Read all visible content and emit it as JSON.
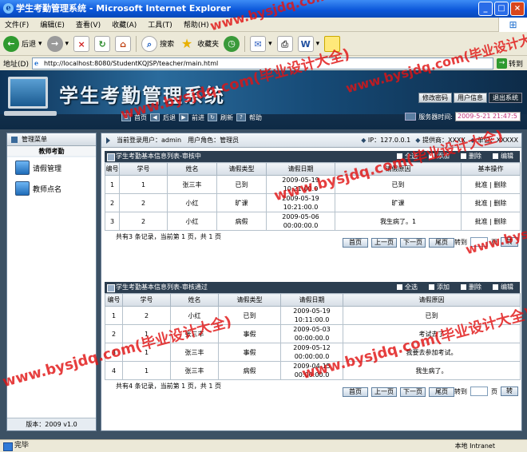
{
  "window": {
    "title": "学生考勤管理系统 - Microsoft Internet Explorer",
    "btn_min": "_",
    "btn_max": "□",
    "btn_close": "×"
  },
  "menu": [
    "文件(F)",
    "编辑(E)",
    "查看(V)",
    "收藏(A)",
    "工具(T)",
    "帮助(H)"
  ],
  "toolbar": {
    "back": "后退",
    "search": "搜索",
    "favorites": "收藏夹"
  },
  "address": {
    "label": "地址(D)",
    "url": "http://localhost:8080/StudentKQJSP/teacher/main.html",
    "go": "转到"
  },
  "header": {
    "title": "学生考勤管理系统",
    "buttons": [
      "修改密码",
      "用户信息",
      "退出系统"
    ],
    "nav": [
      "首页",
      "后退",
      "前进",
      "刷新",
      "帮助"
    ],
    "server_time_label": "服务器时间:",
    "server_time": "2009-5-21 21:47:5"
  },
  "sidebar": {
    "title": "管理菜单",
    "section": "教师考勤",
    "items": [
      "请假管理",
      "教师点名"
    ],
    "version": "版本：2009 v1.0"
  },
  "infobar": {
    "user": "当前登录用户：admin",
    "role": "用户角色：管理员",
    "ip": "IP：127.0.0.1",
    "provider": "提供商：XXXX",
    "unit": "单位：XXXXX"
  },
  "actions": [
    "全选",
    "添加",
    "删除",
    "编辑"
  ],
  "table1": {
    "title": "学生考勤基本信息列表-审核中",
    "headers": [
      "编号",
      "学号",
      "姓名",
      "请假类型",
      "请假日期",
      "请假原因",
      "基本操作"
    ],
    "rows": [
      [
        "1",
        "1",
        "张三丰",
        "已到",
        "2009-05-19 10:21:00.0",
        "已到",
        "批准 | 删除"
      ],
      [
        "2",
        "2",
        "小红",
        "旷课",
        "2009-05-19 10:21:00.0",
        "旷课",
        "批准 | 删除"
      ],
      [
        "3",
        "2",
        "小红",
        "病假",
        "2009-05-06 00:00:00.0",
        "我生病了。1",
        "批准 | 删除"
      ]
    ],
    "pager": "共有3 条记录，当前第 1 页，共 1 页"
  },
  "table2": {
    "title": "学生考勤基本信息列表-审核通过",
    "headers": [
      "编号",
      "学号",
      "姓名",
      "请假类型",
      "请假日期",
      "请假原因"
    ],
    "rows": [
      [
        "1",
        "2",
        "小红",
        "已到",
        "2009-05-19 10:11:00.0",
        "已到"
      ],
      [
        "2",
        "1",
        "张三丰",
        "事假",
        "2009-05-03 00:00:00.0",
        "考试去了"
      ],
      [
        "3",
        "1",
        "张三丰",
        "事假",
        "2009-05-12 00:00:00.0",
        "我要去参加考试。"
      ],
      [
        "4",
        "1",
        "张三丰",
        "病假",
        "2009-04-15 00:00:00.0",
        "我生病了。"
      ]
    ],
    "pager": "共有4 条记录，当前第 1 页，共 1 页"
  },
  "pager_buttons": [
    "首页",
    "上一页",
    "下一页",
    "尾页"
  ],
  "jump": {
    "label": "转到",
    "page_label": "页",
    "button": "转"
  },
  "status": {
    "text": "完毕",
    "zone": "本地 Intranet"
  },
  "watermark": "www.bysjdq.com(毕业设计大全)"
}
